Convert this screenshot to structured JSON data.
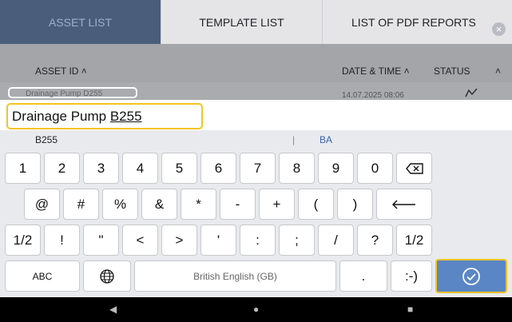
{
  "tabs": [
    {
      "label": "ASSET LIST"
    },
    {
      "label": "TEMPLATE LIST"
    },
    {
      "label": "LIST OF PDF REPORTS"
    }
  ],
  "header": {
    "asset_id": "ASSET ID ˄",
    "date_time": "DATE & TIME ˄",
    "status": "STATUS",
    "collapse": "˄"
  },
  "row": {
    "asset": "Drainage Pump D255",
    "datetime": "14.07.2025 08:06"
  },
  "input": {
    "prefix": "Drainage Pump ",
    "composing": "B255"
  },
  "suggestions": {
    "first": "B255",
    "sep": "|",
    "second": "BA"
  },
  "keys": {
    "row1": [
      "1",
      "2",
      "3",
      "4",
      "5",
      "6",
      "7",
      "8",
      "9",
      "0"
    ],
    "row2": [
      "@",
      "#",
      "%",
      "&",
      "*",
      "-",
      "+",
      "(",
      ")"
    ],
    "row3_left": "1/2",
    "row3": [
      "!",
      "\"",
      "<",
      ">",
      "'",
      ":",
      ";",
      "/",
      "?"
    ],
    "row3_right": "1/2",
    "abc": "ABC",
    "space": "British English (GB)",
    "dot": ".",
    "smiley": ":-)"
  },
  "colors": {
    "active_tab": "#4a5e7c",
    "highlight": "#f4c424",
    "done_key": "#5b86c5"
  },
  "icons": [
    "close-icon",
    "backspace-icon",
    "enter-icon",
    "globe-icon",
    "check-icon",
    "back-icon",
    "home-icon",
    "recents-icon",
    "status-icon"
  ]
}
